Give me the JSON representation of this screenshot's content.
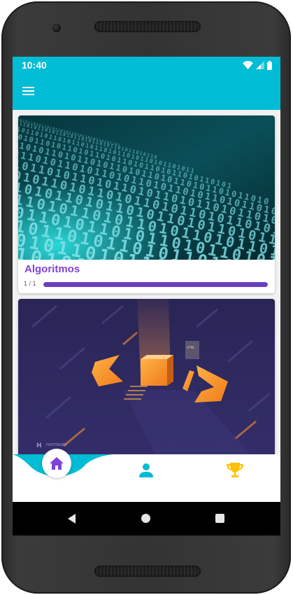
{
  "status_bar": {
    "time": "10:40",
    "icons": [
      "wifi-icon",
      "cell-signal-icon",
      "battery-icon"
    ]
  },
  "app_bar": {
    "menu_icon": "hamburger-menu-icon",
    "color": "#00bcd4"
  },
  "courses": [
    {
      "title": "Algoritmos",
      "progress_text": "1 / 1",
      "progress": 1.0,
      "image": "binary-digits-illustration"
    },
    {
      "title": "",
      "image": "code-brackets-illustration",
      "watermark": "HOSTINGER"
    }
  ],
  "bottom_nav": {
    "items": [
      {
        "icon": "home-icon",
        "active": true
      },
      {
        "icon": "person-icon",
        "active": false
      },
      {
        "icon": "trophy-icon",
        "active": false
      }
    ],
    "accent": "#00bcd4",
    "active_color": "#7e44d8",
    "trophy_color": "#ffc107"
  },
  "system_nav": [
    "back-icon",
    "home-circle-icon",
    "recents-square-icon"
  ],
  "colors": {
    "primary": "#00bcd4",
    "title_purple": "#7e44d8",
    "progress_purple": "#6a3fbf"
  }
}
